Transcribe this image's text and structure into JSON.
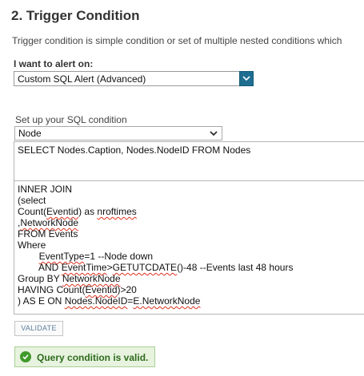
{
  "section": {
    "title": "2. Trigger Condition",
    "description": "Trigger condition is simple condition or set of multiple nested conditions which"
  },
  "alert_on": {
    "label": "I want to alert on:",
    "selected": "Custom SQL Alert (Advanced)",
    "dropdown_icon": "chevron-down-icon",
    "accent_color": "#1f6e91"
  },
  "sql_condition": {
    "label": "Set up your SQL condition",
    "object_selected": "Node",
    "select_clause": "SELECT Nodes.Caption, Nodes.NodeID FROM Nodes",
    "lines": [
      "INNER JOIN",
      "(select",
      "Count(Eventid) as nroftimes",
      ",NetworkNode",
      "FROM Events",
      "Where",
      "        EventType=1 --Node down",
      "        AND EventTime>GETUTCDATE()-48 --Events last 48 hours",
      "Group BY NetworkNode",
      "HAVING Count(Eventid)>20",
      ") AS E ON Nodes.NodeID=E.NetworkNode"
    ]
  },
  "validate_button": "VALIDATE",
  "validation": {
    "message": "Query condition is valid.",
    "status_color": "#3f9a2a"
  }
}
